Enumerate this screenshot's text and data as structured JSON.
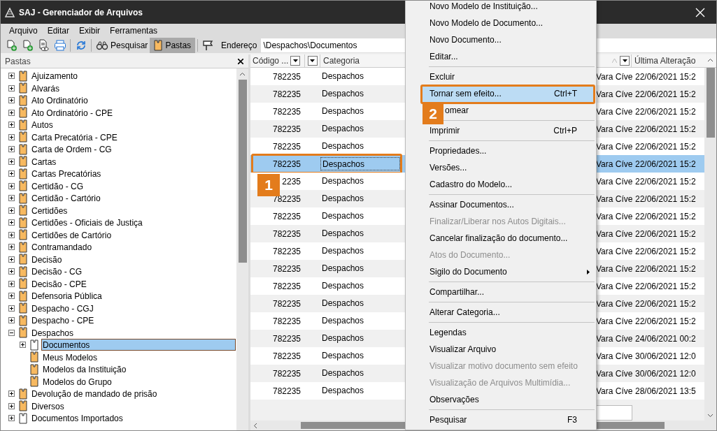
{
  "window": {
    "title": "SAJ - Gerenciador de Arquivos"
  },
  "menu_bar": [
    "Arquivo",
    "Editar",
    "Exibir",
    "Ferramentas"
  ],
  "toolbar": {
    "search_button": "Pesquisar",
    "folders_button": {
      "label": "Pastas",
      "pressed": true
    },
    "address_label": "Endereço",
    "address_value": "\\Despachos\\Documentos"
  },
  "folders_panel": {
    "title": "Pastas",
    "tree": [
      {
        "label": "Ajuizamento",
        "kind": "folder",
        "expanded": false,
        "selected": false
      },
      {
        "label": "Alvarás",
        "kind": "folder",
        "expanded": false,
        "selected": false
      },
      {
        "label": "Ato Ordinatório",
        "kind": "folder",
        "expanded": false,
        "selected": false
      },
      {
        "label": "Ato Ordinatório - CPE",
        "kind": "folder",
        "expanded": false,
        "selected": false
      },
      {
        "label": "Autos",
        "kind": "folder",
        "expanded": false,
        "selected": false
      },
      {
        "label": "Carta Precatória - CPE",
        "kind": "folder",
        "expanded": false,
        "selected": false
      },
      {
        "label": "Carta de Ordem - CG",
        "kind": "folder",
        "expanded": false,
        "selected": false
      },
      {
        "label": "Cartas",
        "kind": "folder",
        "expanded": false,
        "selected": false
      },
      {
        "label": "Cartas Precatórias",
        "kind": "folder",
        "expanded": false,
        "selected": false
      },
      {
        "label": "Certidão - CG",
        "kind": "folder",
        "expanded": false,
        "selected": false
      },
      {
        "label": "Certidão - Cartório",
        "kind": "folder",
        "expanded": false,
        "selected": false
      },
      {
        "label": "Certidões",
        "kind": "folder",
        "expanded": false,
        "selected": false
      },
      {
        "label": "Certidões - Oficiais de Justiça",
        "kind": "folder",
        "expanded": false,
        "selected": false
      },
      {
        "label": "Certidões de Cartório",
        "kind": "folder",
        "expanded": false,
        "selected": false
      },
      {
        "label": "Contramandado",
        "kind": "folder",
        "expanded": false,
        "selected": false
      },
      {
        "label": "Decisão",
        "kind": "folder",
        "expanded": false,
        "selected": false
      },
      {
        "label": "Decisão - CG",
        "kind": "folder",
        "expanded": false,
        "selected": false
      },
      {
        "label": "Decisão - CPE",
        "kind": "folder",
        "expanded": false,
        "selected": false
      },
      {
        "label": "Defensoria Pública",
        "kind": "folder",
        "expanded": false,
        "selected": false
      },
      {
        "label": "Despacho - CGJ",
        "kind": "folder",
        "expanded": false,
        "selected": false
      },
      {
        "label": "Despacho - CPE",
        "kind": "folder",
        "expanded": false,
        "selected": false
      },
      {
        "label": "Despachos",
        "kind": "folder",
        "expanded": true,
        "selected": false,
        "children": [
          {
            "label": "Documentos",
            "kind": "blank",
            "expanded": false,
            "selected": true
          },
          {
            "label": "Meus Modelos",
            "kind": "folder",
            "selected": false
          },
          {
            "label": "Modelos da Instituição",
            "kind": "folder",
            "selected": false
          },
          {
            "label": "Modelos do Grupo",
            "kind": "folder",
            "selected": false
          }
        ]
      },
      {
        "label": "Devolução de mandado de prisão",
        "kind": "folder",
        "expanded": false,
        "selected": false
      },
      {
        "label": "Diversos",
        "kind": "folder",
        "expanded": false,
        "selected": false
      },
      {
        "label": "Documentos Importados",
        "kind": "blank",
        "expanded": false,
        "selected": false
      }
    ]
  },
  "grid": {
    "columns": [
      "Código ...",
      "Categoria",
      "Última Alteração"
    ],
    "rows": [
      {
        "code": "782235",
        "category": "Despachos",
        "court": "Vara Cíve",
        "date": "22/06/2021 15:2",
        "selected": false
      },
      {
        "code": "782235",
        "category": "Despachos",
        "court": "Vara Cíve",
        "date": "22/06/2021 15:2",
        "selected": false
      },
      {
        "code": "782235",
        "category": "Despachos",
        "court": "Vara Cíve",
        "date": "22/06/2021 15:2",
        "selected": false
      },
      {
        "code": "782235",
        "category": "Despachos",
        "court": "Vara Cíve",
        "date": "22/06/2021 15:2",
        "selected": false
      },
      {
        "code": "782235",
        "category": "Despachos",
        "court": "Vara Cíve",
        "date": "22/06/2021 15:2",
        "selected": false
      },
      {
        "code": "782235",
        "category": "Despachos",
        "court": "Vara Cíve",
        "date": "22/06/2021 15:2",
        "selected": true
      },
      {
        "code": "2235",
        "category": "Despachos",
        "court": "Vara Cíve",
        "date": "22/06/2021 15:2",
        "selected": false,
        "callout": "1"
      },
      {
        "code": "782235",
        "category": "Despachos",
        "court": "Vara Cíve",
        "date": "22/06/2021 15:2",
        "selected": false
      },
      {
        "code": "782235",
        "category": "Despachos",
        "court": "Vara Cíve",
        "date": "22/06/2021 15:2",
        "selected": false
      },
      {
        "code": "782235",
        "category": "Despachos",
        "court": "Vara Cíve",
        "date": "22/06/2021 15:2",
        "selected": false
      },
      {
        "code": "782235",
        "category": "Despachos",
        "court": "Vara Cíve",
        "date": "22/06/2021 15:2",
        "selected": false
      },
      {
        "code": "782235",
        "category": "Despachos",
        "court": "Vara Cíve",
        "date": "22/06/2021 15:2",
        "selected": false
      },
      {
        "code": "782235",
        "category": "Despachos",
        "court": "Vara Cíve",
        "date": "22/06/2021 15:2",
        "selected": false
      },
      {
        "code": "782235",
        "category": "Despachos",
        "court": "Vara Cíve",
        "date": "22/06/2021 15:2",
        "selected": false
      },
      {
        "code": "782235",
        "category": "Despachos",
        "court": "Vara Cíve",
        "date": "22/06/2021 15:2",
        "selected": false
      },
      {
        "code": "782235",
        "category": "Despachos",
        "court": "Vara Cíve",
        "date": "24/06/2021 00:2",
        "selected": false
      },
      {
        "code": "782235",
        "category": "Despachos",
        "court": "Vara Cíve",
        "date": "30/06/2021 12:0",
        "selected": false
      },
      {
        "code": "782235",
        "category": "Despachos",
        "court": "Vara Cíve",
        "date": "30/06/2021 12:0",
        "selected": false
      },
      {
        "code": "782235",
        "category": "Despachos",
        "court": "Vara Cíve",
        "date": "28/06/2021 13:5",
        "selected": false
      }
    ]
  },
  "context_menu": {
    "items": [
      {
        "kind": "item",
        "label": "Novo Modelo de Instituição...",
        "disabled": false,
        "selected": false
      },
      {
        "kind": "item",
        "label": "Novo Modelo de Documento...",
        "disabled": false,
        "selected": false
      },
      {
        "kind": "item",
        "label": "Novo Documento...",
        "disabled": false,
        "selected": false
      },
      {
        "kind": "item",
        "label": "Editar...",
        "disabled": false,
        "selected": false
      },
      {
        "kind": "separator"
      },
      {
        "kind": "item",
        "label": "Excluir",
        "disabled": false,
        "selected": false
      },
      {
        "kind": "item",
        "label": "Tornar sem efeito...",
        "shortcut": "Ctrl+T",
        "disabled": false,
        "selected": true
      },
      {
        "kind": "item",
        "label": "omear",
        "disabled": false,
        "selected": false,
        "callout": "2"
      },
      {
        "kind": "separator"
      },
      {
        "kind": "item",
        "label": "Imprimir",
        "shortcut": "Ctrl+P",
        "disabled": false,
        "selected": false
      },
      {
        "kind": "separator"
      },
      {
        "kind": "item",
        "label": "Propriedades...",
        "disabled": false,
        "selected": false
      },
      {
        "kind": "item",
        "label": "Versões...",
        "disabled": false,
        "selected": false
      },
      {
        "kind": "item",
        "label": "Cadastro do Modelo...",
        "disabled": false,
        "selected": false
      },
      {
        "kind": "separator"
      },
      {
        "kind": "item",
        "label": "Assinar Documentos...",
        "disabled": false,
        "selected": false
      },
      {
        "kind": "item",
        "label": "Finalizar/Liberar nos Autos Digitais...",
        "disabled": true,
        "selected": false
      },
      {
        "kind": "item",
        "label": "Cancelar finalização do documento...",
        "disabled": false,
        "selected": false
      },
      {
        "kind": "item",
        "label": "Atos do Documento...",
        "disabled": true,
        "selected": false
      },
      {
        "kind": "submenu",
        "label": "Sigilo do Documento",
        "disabled": false,
        "selected": false
      },
      {
        "kind": "separator"
      },
      {
        "kind": "item",
        "label": "Compartilhar...",
        "disabled": false,
        "selected": false
      },
      {
        "kind": "separator"
      },
      {
        "kind": "item",
        "label": "Alterar Categoria...",
        "disabled": false,
        "selected": false
      },
      {
        "kind": "separator"
      },
      {
        "kind": "item",
        "label": "Legendas",
        "disabled": false,
        "selected": false
      },
      {
        "kind": "item",
        "label": "Visualizar Arquivo",
        "disabled": false,
        "selected": false
      },
      {
        "kind": "item",
        "label": "Visualizar motivo documento sem efeito",
        "disabled": true,
        "selected": false
      },
      {
        "kind": "item",
        "label": "Visualização de Arquivos Multimídia...",
        "disabled": true,
        "selected": false
      },
      {
        "kind": "item",
        "label": "Observações",
        "disabled": false,
        "selected": false
      },
      {
        "kind": "separator"
      },
      {
        "kind": "item",
        "label": "Pesquisar",
        "shortcut": "F3",
        "disabled": false,
        "selected": false
      }
    ]
  }
}
